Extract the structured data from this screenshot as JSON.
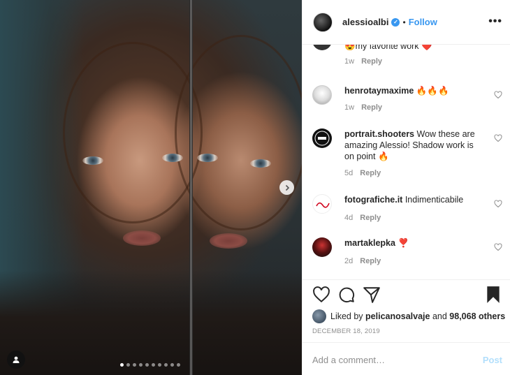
{
  "post": {
    "username": "alessioalbi",
    "verified_mark": "✓",
    "separator": "•",
    "follow_label": "Follow",
    "more_label": "•••"
  },
  "comments": [
    {
      "username": "",
      "text": "😍my favorite work ❤️",
      "time": "1w",
      "reply_label": "Reply"
    },
    {
      "username": "henrotaymaxime",
      "text": "🔥🔥🔥",
      "time": "1w",
      "reply_label": "Reply"
    },
    {
      "username": "portrait.shooters",
      "text": "Wow these are amazing Alessio! Shadow work is on point 🔥",
      "time": "5d",
      "reply_label": "Reply"
    },
    {
      "username": "fotografiche.it",
      "text": "Indimenticabile",
      "time": "4d",
      "reply_label": "Reply"
    },
    {
      "username": "martaklepka",
      "text": "❣️",
      "time": "2d",
      "reply_label": "Reply"
    }
  ],
  "likes": {
    "prefix": "Liked by",
    "user": "pelicanosalvaje",
    "conjunction": "and",
    "others": "98,068 others"
  },
  "date": "DECEMBER 18, 2019",
  "comment_input": {
    "placeholder": "Add a comment…",
    "post_label": "Post"
  },
  "carousel": {
    "slide_count": 10,
    "active_index": 0
  },
  "colors": {
    "accent": "#3897f0",
    "post_disabled": "#b2dffc",
    "muted": "#8e8e8e",
    "text": "#262626"
  },
  "icons": [
    "heart-icon",
    "comment-icon",
    "share-icon",
    "bookmark-icon",
    "chevron-right-icon",
    "user-tag-icon",
    "more-icon",
    "verified-icon"
  ]
}
